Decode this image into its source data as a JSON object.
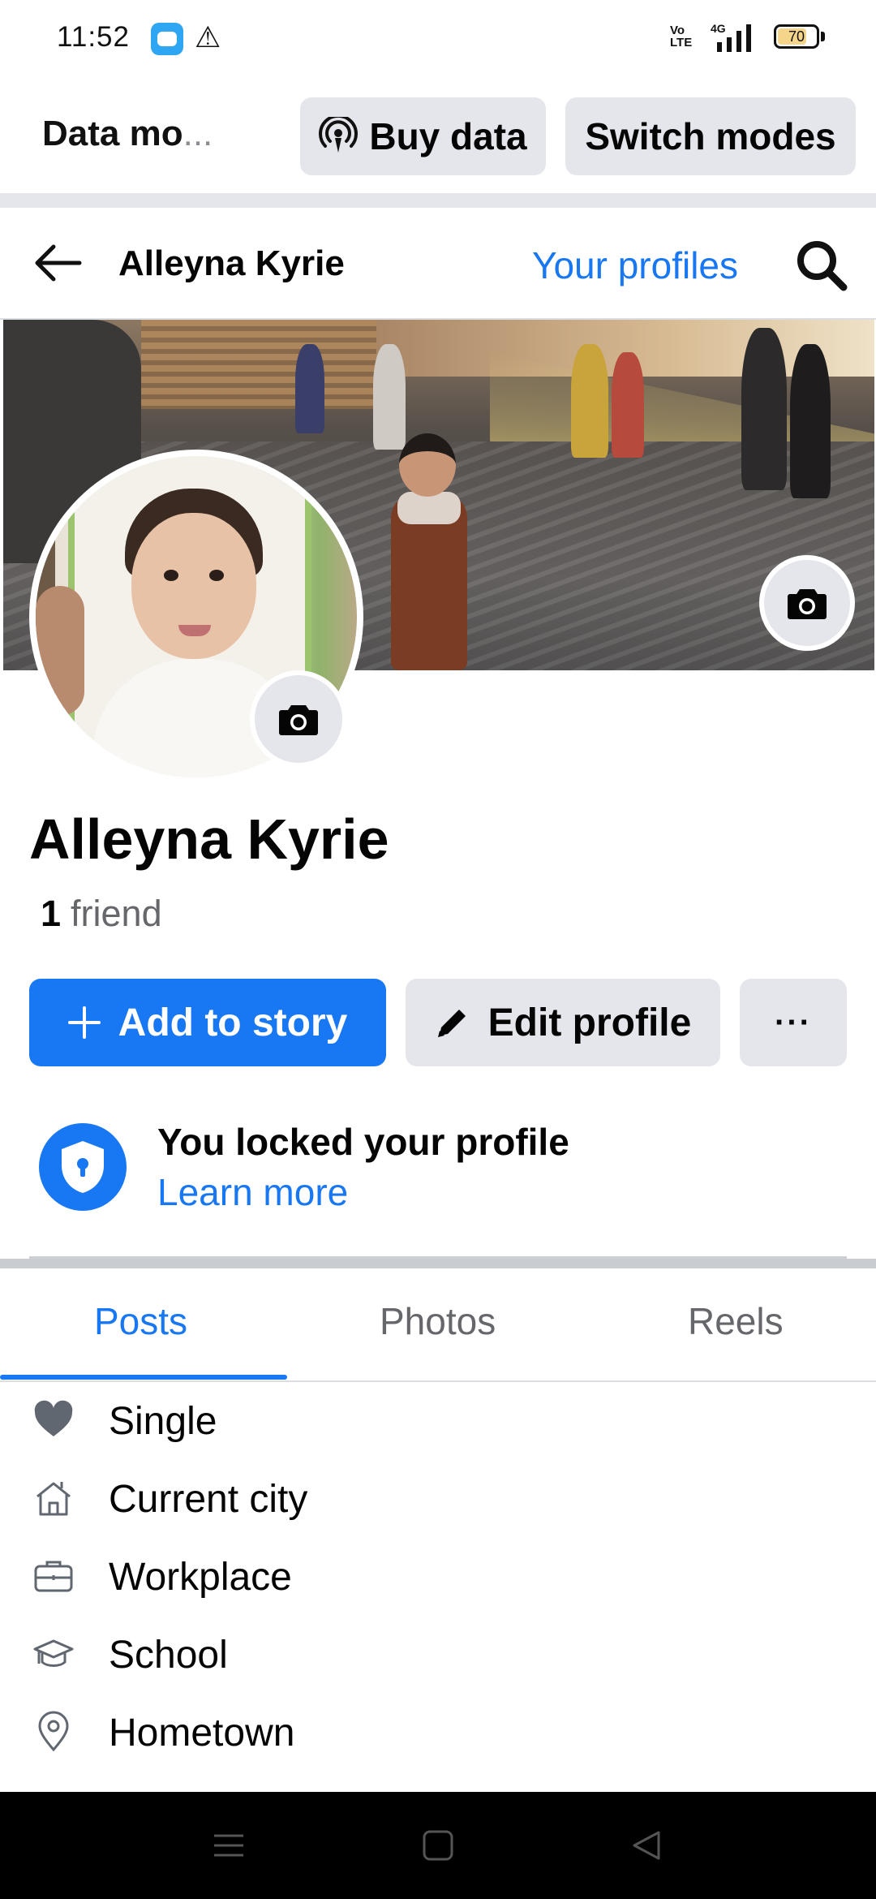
{
  "status_bar": {
    "time": "11:52",
    "network": "4G",
    "volte": "Vo LTE",
    "battery": "70",
    "battery_level": 0.7
  },
  "data_mode": {
    "label": "Data mo",
    "ellipsis": "...",
    "buy_label": "Buy data",
    "switch_label": "Switch modes"
  },
  "header": {
    "title": "Alleyna Kyrie",
    "your_profiles": "Your profiles"
  },
  "profile": {
    "name": "Alleyna Kyrie",
    "friend_count": "1",
    "friend_label": "friend"
  },
  "actions": {
    "add_story": "Add to story",
    "edit_profile": "Edit profile",
    "more": "···"
  },
  "lock_notice": {
    "title": "You locked your profile",
    "link": "Learn more"
  },
  "tabs": [
    {
      "label": "Posts",
      "active": true
    },
    {
      "label": "Photos",
      "active": false
    },
    {
      "label": "Reels",
      "active": false
    }
  ],
  "details": [
    {
      "icon": "heart-icon",
      "label": "Single"
    },
    {
      "icon": "house-icon",
      "label": "Current city"
    },
    {
      "icon": "briefcase-icon",
      "label": "Workplace"
    },
    {
      "icon": "graduation-cap-icon",
      "label": "School"
    },
    {
      "icon": "location-pin-icon",
      "label": "Hometown"
    }
  ],
  "colors": {
    "brand_blue": "#1877f2",
    "button_gray": "#e4e6eb",
    "secondary_text": "#65676b"
  }
}
